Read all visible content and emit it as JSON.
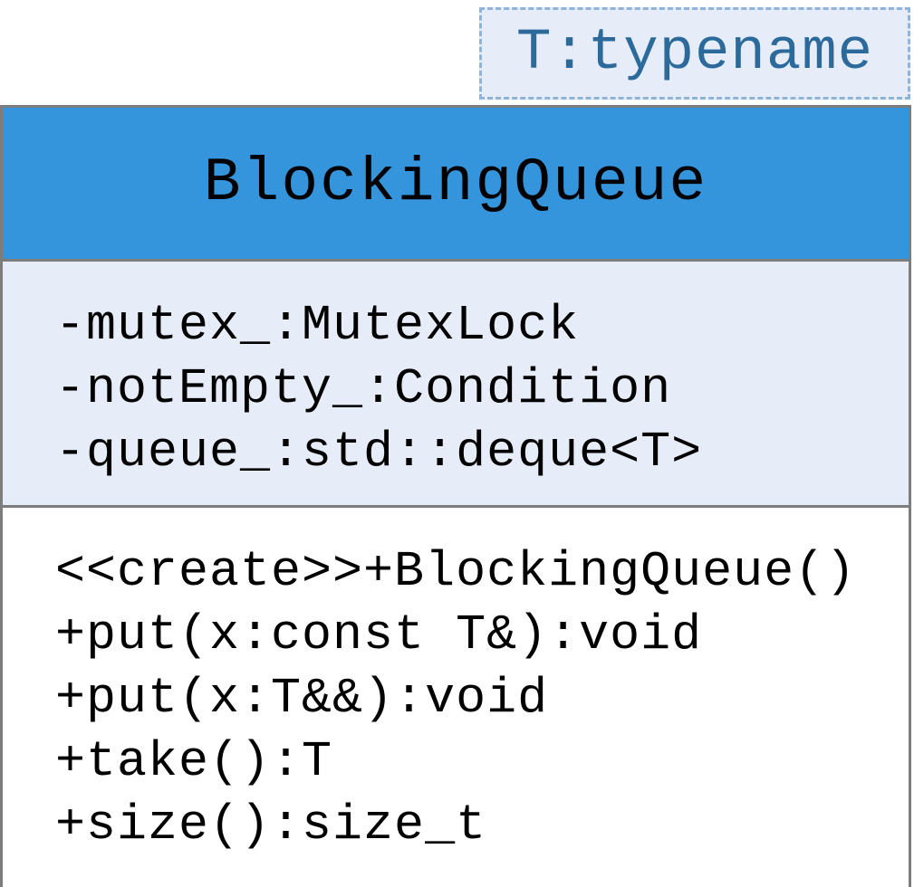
{
  "template_parameter": "T:typename",
  "class": {
    "name": "BlockingQueue",
    "attributes": [
      "-mutex_:MutexLock",
      "-notEmpty_:Condition",
      "-queue_:std::deque<T>"
    ],
    "operations": [
      "<<create>>+BlockingQueue()",
      "+put(x:const T&):void",
      "+put(x:T&&):void",
      "+take():T",
      "+size():size_t"
    ]
  },
  "colors": {
    "header_fill": "#3595dc",
    "attribute_fill": "#e6edf8",
    "template_border": "#8fb4d9",
    "template_text": "#2b6a9b",
    "outline": "#7d7d7d"
  }
}
